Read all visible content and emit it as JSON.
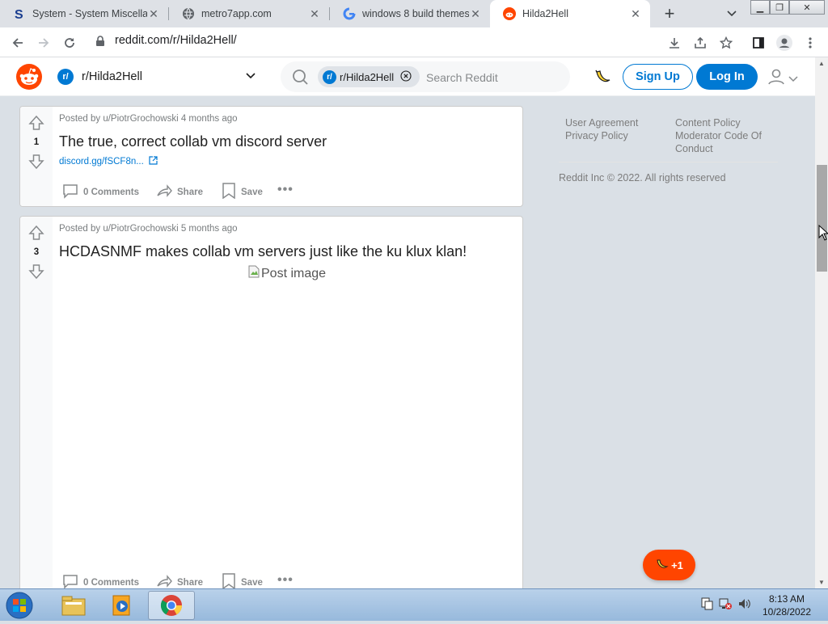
{
  "browser": {
    "tabs": [
      {
        "title": "System - System Miscellaneous",
        "favicon": "s-logo-icon",
        "active": false
      },
      {
        "title": "metro7app.com",
        "favicon": "globe-icon",
        "active": false
      },
      {
        "title": "windows 8 build themes",
        "favicon": "google-icon",
        "active": false
      },
      {
        "title": "Hilda2Hell",
        "favicon": "reddit-icon",
        "active": true
      }
    ],
    "url": "reddit.com/r/Hilda2Hell/"
  },
  "header": {
    "subreddit_prefix": "r/",
    "subreddit": "r/Hilda2Hell",
    "search_pill": "r/Hilda2Hell",
    "search_placeholder": "Search Reddit",
    "signup_label": "Sign Up",
    "login_label": "Log In"
  },
  "posts": [
    {
      "votes": "1",
      "meta": "Posted by u/PiotrGrochowski 4 months ago",
      "title": "The true, correct collab vm discord server",
      "link": "discord.gg/fSCF8n...",
      "comments": "0 Comments",
      "share": "Share",
      "save": "Save"
    },
    {
      "votes": "3",
      "meta": "Posted by u/PiotrGrochowski 5 months ago",
      "title": "HCDASNMF makes collab vm servers just like the ku klux klan!",
      "image_alt": "Post image",
      "comments": "0 Comments",
      "share": "Share",
      "save": "Save"
    }
  ],
  "sidebar": {
    "links_col1": [
      "User Agreement",
      "Privacy Policy"
    ],
    "links_col2": [
      "Content Policy",
      "Moderator Code Of",
      "Conduct"
    ],
    "copyright": "Reddit Inc © 2022. All rights reserved"
  },
  "fab": {
    "label": "+1"
  },
  "taskbar": {
    "time": "8:13 AM",
    "date": "10/28/2022"
  },
  "colors": {
    "reddit_orange": "#ff4500",
    "reddit_blue": "#0079d3",
    "page_bg": "#dae0e6"
  }
}
